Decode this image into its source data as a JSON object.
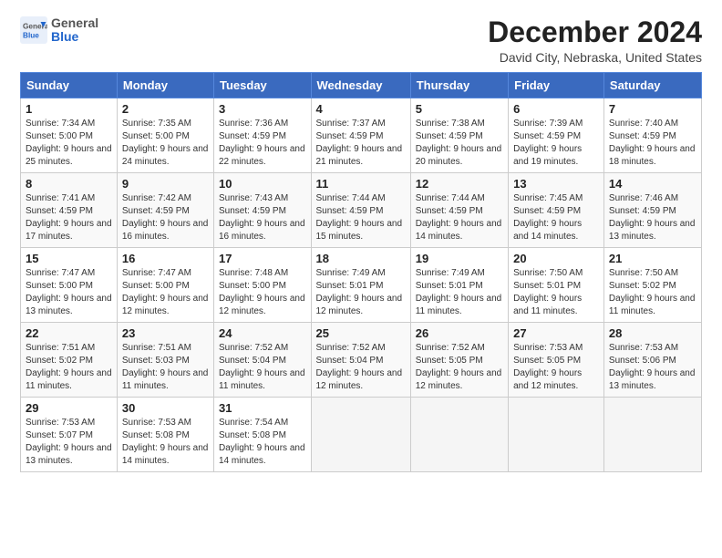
{
  "header": {
    "logo_general": "General",
    "logo_blue": "Blue",
    "month_title": "December 2024",
    "location": "David City, Nebraska, United States"
  },
  "weekdays": [
    "Sunday",
    "Monday",
    "Tuesday",
    "Wednesday",
    "Thursday",
    "Friday",
    "Saturday"
  ],
  "weeks": [
    [
      {
        "day": "1",
        "sunrise": "7:34 AM",
        "sunset": "5:00 PM",
        "daylight": "9 hours and 25 minutes."
      },
      {
        "day": "2",
        "sunrise": "7:35 AM",
        "sunset": "5:00 PM",
        "daylight": "9 hours and 24 minutes."
      },
      {
        "day": "3",
        "sunrise": "7:36 AM",
        "sunset": "4:59 PM",
        "daylight": "9 hours and 22 minutes."
      },
      {
        "day": "4",
        "sunrise": "7:37 AM",
        "sunset": "4:59 PM",
        "daylight": "9 hours and 21 minutes."
      },
      {
        "day": "5",
        "sunrise": "7:38 AM",
        "sunset": "4:59 PM",
        "daylight": "9 hours and 20 minutes."
      },
      {
        "day": "6",
        "sunrise": "7:39 AM",
        "sunset": "4:59 PM",
        "daylight": "9 hours and 19 minutes."
      },
      {
        "day": "7",
        "sunrise": "7:40 AM",
        "sunset": "4:59 PM",
        "daylight": "9 hours and 18 minutes."
      }
    ],
    [
      {
        "day": "8",
        "sunrise": "7:41 AM",
        "sunset": "4:59 PM",
        "daylight": "9 hours and 17 minutes."
      },
      {
        "day": "9",
        "sunrise": "7:42 AM",
        "sunset": "4:59 PM",
        "daylight": "9 hours and 16 minutes."
      },
      {
        "day": "10",
        "sunrise": "7:43 AM",
        "sunset": "4:59 PM",
        "daylight": "9 hours and 16 minutes."
      },
      {
        "day": "11",
        "sunrise": "7:44 AM",
        "sunset": "4:59 PM",
        "daylight": "9 hours and 15 minutes."
      },
      {
        "day": "12",
        "sunrise": "7:44 AM",
        "sunset": "4:59 PM",
        "daylight": "9 hours and 14 minutes."
      },
      {
        "day": "13",
        "sunrise": "7:45 AM",
        "sunset": "4:59 PM",
        "daylight": "9 hours and 14 minutes."
      },
      {
        "day": "14",
        "sunrise": "7:46 AM",
        "sunset": "4:59 PM",
        "daylight": "9 hours and 13 minutes."
      }
    ],
    [
      {
        "day": "15",
        "sunrise": "7:47 AM",
        "sunset": "5:00 PM",
        "daylight": "9 hours and 13 minutes."
      },
      {
        "day": "16",
        "sunrise": "7:47 AM",
        "sunset": "5:00 PM",
        "daylight": "9 hours and 12 minutes."
      },
      {
        "day": "17",
        "sunrise": "7:48 AM",
        "sunset": "5:00 PM",
        "daylight": "9 hours and 12 minutes."
      },
      {
        "day": "18",
        "sunrise": "7:49 AM",
        "sunset": "5:01 PM",
        "daylight": "9 hours and 12 minutes."
      },
      {
        "day": "19",
        "sunrise": "7:49 AM",
        "sunset": "5:01 PM",
        "daylight": "9 hours and 11 minutes."
      },
      {
        "day": "20",
        "sunrise": "7:50 AM",
        "sunset": "5:01 PM",
        "daylight": "9 hours and 11 minutes."
      },
      {
        "day": "21",
        "sunrise": "7:50 AM",
        "sunset": "5:02 PM",
        "daylight": "9 hours and 11 minutes."
      }
    ],
    [
      {
        "day": "22",
        "sunrise": "7:51 AM",
        "sunset": "5:02 PM",
        "daylight": "9 hours and 11 minutes."
      },
      {
        "day": "23",
        "sunrise": "7:51 AM",
        "sunset": "5:03 PM",
        "daylight": "9 hours and 11 minutes."
      },
      {
        "day": "24",
        "sunrise": "7:52 AM",
        "sunset": "5:04 PM",
        "daylight": "9 hours and 11 minutes."
      },
      {
        "day": "25",
        "sunrise": "7:52 AM",
        "sunset": "5:04 PM",
        "daylight": "9 hours and 12 minutes."
      },
      {
        "day": "26",
        "sunrise": "7:52 AM",
        "sunset": "5:05 PM",
        "daylight": "9 hours and 12 minutes."
      },
      {
        "day": "27",
        "sunrise": "7:53 AM",
        "sunset": "5:05 PM",
        "daylight": "9 hours and 12 minutes."
      },
      {
        "day": "28",
        "sunrise": "7:53 AM",
        "sunset": "5:06 PM",
        "daylight": "9 hours and 13 minutes."
      }
    ],
    [
      {
        "day": "29",
        "sunrise": "7:53 AM",
        "sunset": "5:07 PM",
        "daylight": "9 hours and 13 minutes."
      },
      {
        "day": "30",
        "sunrise": "7:53 AM",
        "sunset": "5:08 PM",
        "daylight": "9 hours and 14 minutes."
      },
      {
        "day": "31",
        "sunrise": "7:54 AM",
        "sunset": "5:08 PM",
        "daylight": "9 hours and 14 minutes."
      },
      null,
      null,
      null,
      null
    ]
  ],
  "labels": {
    "sunrise": "Sunrise: ",
    "sunset": "Sunset: ",
    "daylight": "Daylight: "
  }
}
